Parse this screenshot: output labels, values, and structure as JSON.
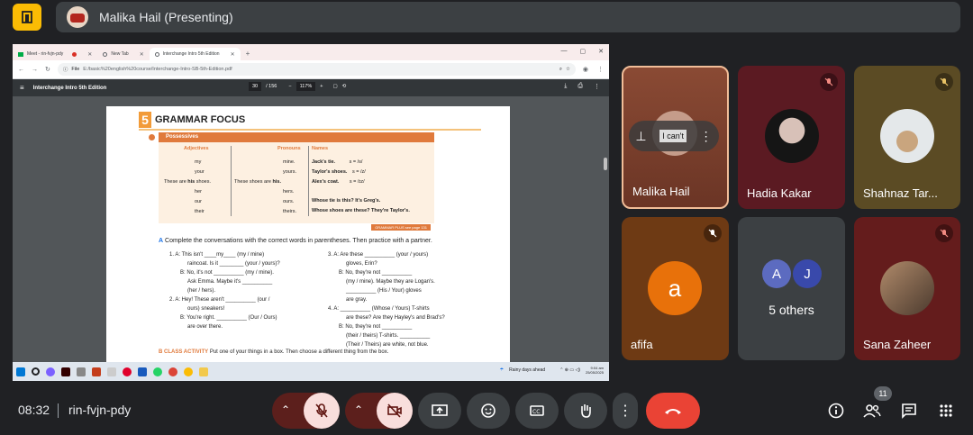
{
  "header": {
    "presenter_title": "Malika Hail (Presenting)"
  },
  "browser": {
    "tabs": [
      {
        "label": "Meet - rin-fvjn-pdy"
      },
      {
        "label": "New Tab"
      },
      {
        "label": "Interchange Intro 5th Edition"
      }
    ],
    "url_prefix": "File",
    "url": "E:/basic%20english%20course/Interchange-Intro-SB-5th-Edition.pdf"
  },
  "pdf_viewer": {
    "title": "Interchange Intro 5th Edition",
    "page_current": "30",
    "page_total": "/ 156",
    "zoom": "117%"
  },
  "document": {
    "section_number": "5",
    "section_title": "GRAMMAR FOCUS",
    "possessives_label": "Possessives",
    "col_adjectives": "Adjectives",
    "col_pronouns": "Pronouns",
    "col_names": "Names",
    "adjectives": [
      "my",
      "your",
      "his",
      "her",
      "our",
      "their"
    ],
    "these_are": "These are",
    "shoes": "shoes.",
    "these_shoes_are": "These shoes are",
    "pronouns": [
      "mine.",
      "yours.",
      "his.",
      "hers.",
      "ours.",
      "theirs."
    ],
    "names": [
      {
        "name": "Jack's tie.",
        "sound": "s = /s/"
      },
      {
        "name": "Taylor's shoes.",
        "sound": "s = /z/"
      },
      {
        "name": "Alex's coat.",
        "sound": "s = /ɪz/"
      }
    ],
    "whose_1": "Whose tie is this? It's Greg's.",
    "whose_2": "Whose shoes are these? They're Taylor's.",
    "grammar_plus": "GRAMMAR PLUS see page 131",
    "task_a": "Complete the conversations with the correct words in parentheses. Then practice with a partner.",
    "task_a_letter": "A",
    "conv_left": [
      "1. A: This isn't ____my____ (my / mine)",
      "raincoat. Is it ________ (your / yours)?",
      "B: No, it's not __________ (my / mine).",
      "Ask Emma. Maybe it's __________",
      "(her / hers).",
      "2. A: Hey! These aren't __________ (our /",
      "ours) sneakers!",
      "B: You're right. __________ (Our / Ours)",
      "are over there."
    ],
    "conv_right": [
      "3. A: Are these __________ (your / yours)",
      "gloves, Erin?",
      "B: No, they're not __________",
      "(my / mine). Maybe they are Logan's.",
      "__________ (His / Your) gloves",
      "are gray.",
      "4. A: __________ (Whose / Yours) T-shirts",
      "are these? Are they Hayley's and Brad's?",
      "B: No, they're not __________",
      "(their / theirs) T-shirts. __________",
      "(Their / Theirs) are white, not blue."
    ],
    "task_b_letter": "B",
    "task_b_title": "CLASS ACTIVITY",
    "task_b": "Put one of your things in a box. Then choose a different thing from the box."
  },
  "taskbar": {
    "weather": "Rainy days ahead",
    "time": "9:04 am",
    "date": "25/05/2025"
  },
  "participants": [
    {
      "name": "Malika Hail",
      "sign_text": "I can't"
    },
    {
      "name": "Hadia Kakar"
    },
    {
      "name": "Shahnaz Tar..."
    },
    {
      "name": "afifa",
      "initial": "a"
    },
    {
      "name": "5 others",
      "initials": [
        "A",
        "J"
      ]
    },
    {
      "name": "Sana Zaheer"
    }
  ],
  "meeting": {
    "time": "08:32",
    "code": "rin-fvjn-pdy",
    "people_count": "11"
  },
  "colors": {
    "accent_red": "#ea4335",
    "mic_off_bg": "#f9dedc",
    "afifa": "#e8710a"
  }
}
